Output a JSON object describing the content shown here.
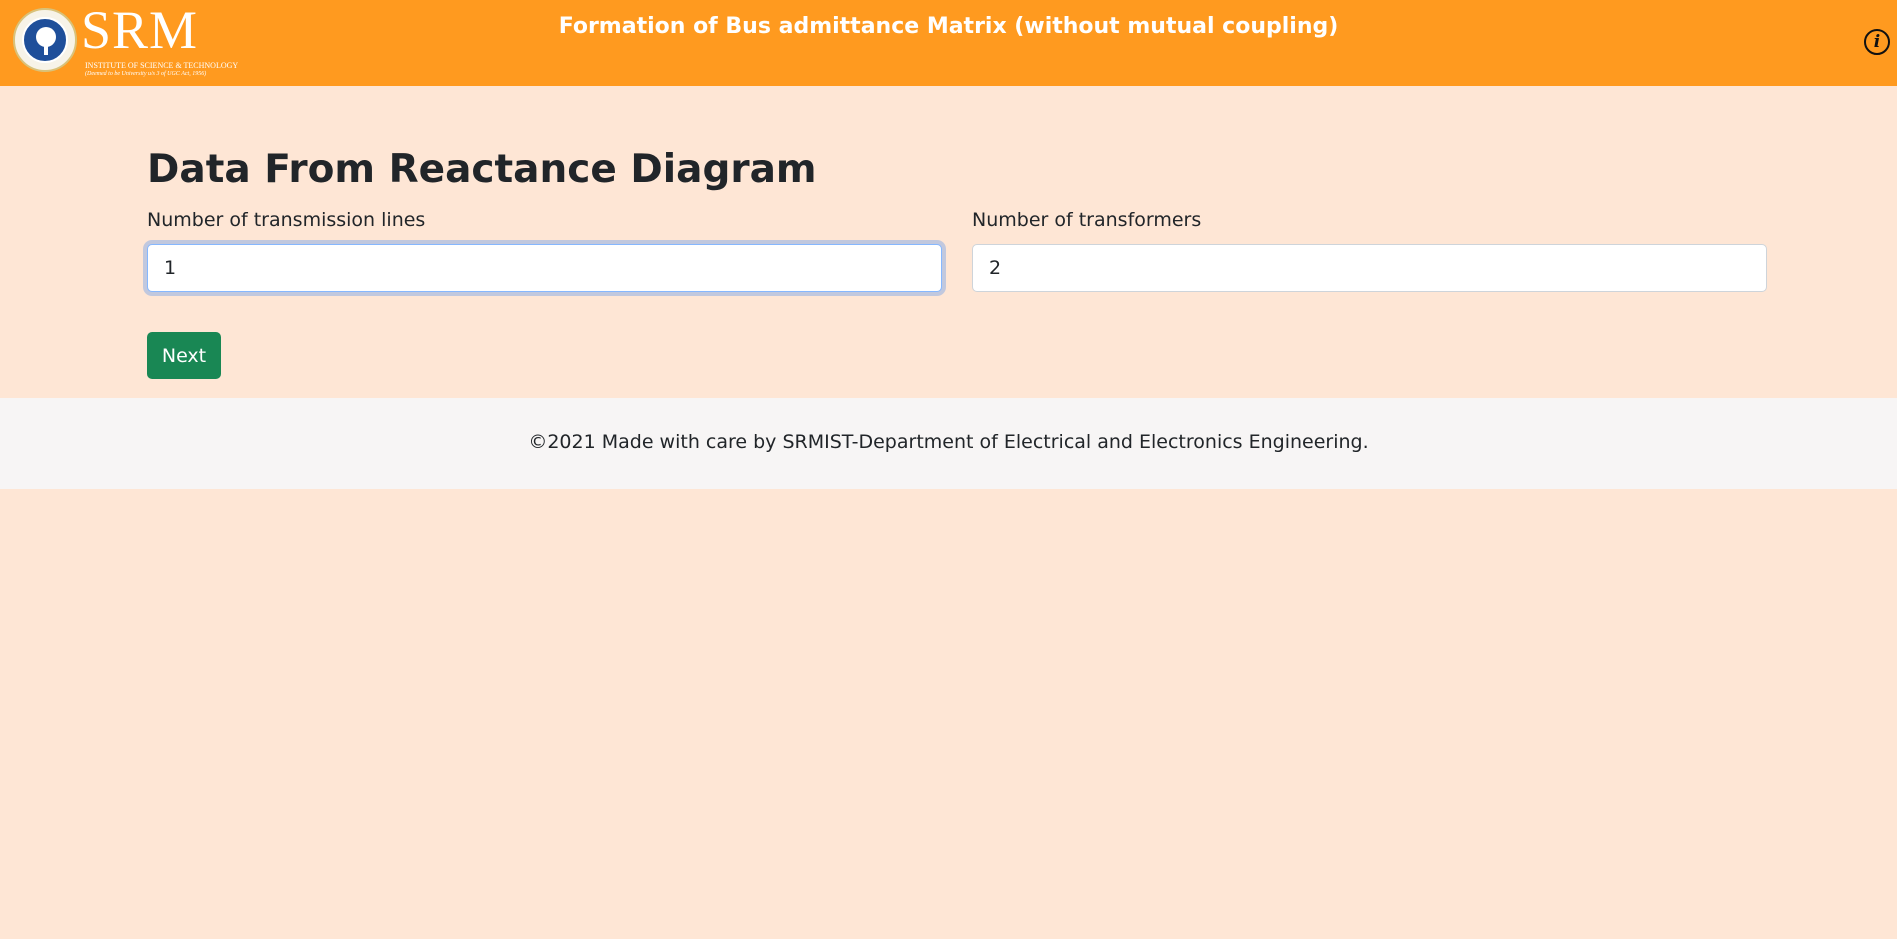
{
  "header": {
    "logo_text": "SRM",
    "logo_subtitle": "INSTITUTE OF SCIENCE & TECHNOLOGY",
    "logo_tagline": "(Deemed to be University u/s 3 of UGC Act, 1956)",
    "title": "Formation of Bus admittance Matrix (without mutual coupling)",
    "info_icon": "i"
  },
  "main": {
    "heading": "Data From Reactance Diagram",
    "fields": [
      {
        "label": "Number of transmission lines",
        "value": "1"
      },
      {
        "label": "Number of transformers",
        "value": "2"
      }
    ],
    "next_label": "Next"
  },
  "footer": {
    "text": "©2021 Made with care by SRMIST-Department of Electrical and Electronics Engineering."
  },
  "colors": {
    "header_bg": "#ff9a1f",
    "page_bg": "#fee6d5",
    "button_bg": "#198754",
    "footer_bg": "#f7f5f5"
  }
}
